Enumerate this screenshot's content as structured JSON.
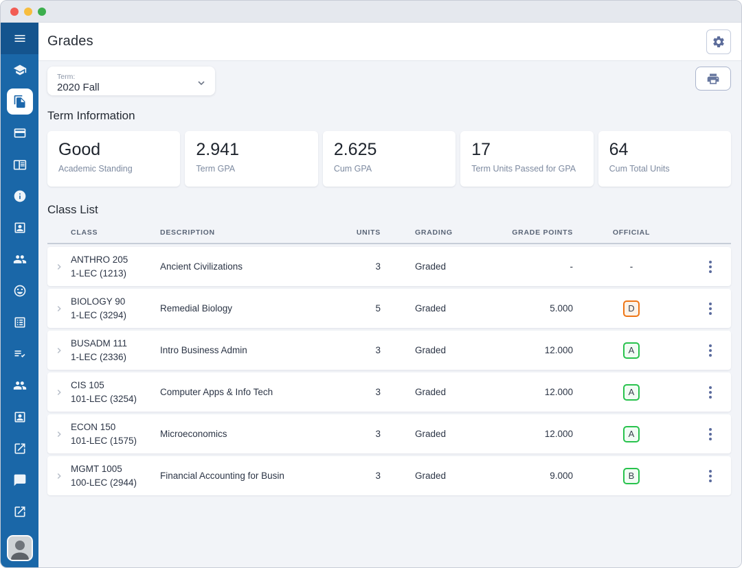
{
  "header": {
    "title": "Grades"
  },
  "toolbar": {
    "term_label": "Term:",
    "term_value": "2020 Fall"
  },
  "term_information": {
    "heading": "Term Information",
    "cards": [
      {
        "value": "Good",
        "label": "Academic Standing"
      },
      {
        "value": "2.941",
        "label": "Term GPA"
      },
      {
        "value": "2.625",
        "label": "Cum GPA"
      },
      {
        "value": "17",
        "label": "Term Units Passed for GPA"
      },
      {
        "value": "64",
        "label": "Cum Total Units"
      }
    ]
  },
  "class_list": {
    "heading": "Class List",
    "columns": [
      "Class",
      "Description",
      "Units",
      "Grading",
      "Grade Points",
      "Official"
    ],
    "rows": [
      {
        "class_code": "ANTHRO 205",
        "section": "1-LEC (1213)",
        "description": "Ancient Civilizations",
        "units": "3",
        "grading": "Graded",
        "grade_points": "-",
        "official": "-",
        "official_type": "none"
      },
      {
        "class_code": "BIOLOGY 90",
        "section": "1-LEC (3294)",
        "description": "Remedial Biology",
        "units": "5",
        "grading": "Graded",
        "grade_points": "5.000",
        "official": "D",
        "official_type": "warning"
      },
      {
        "class_code": "BUSADM 111",
        "section": "1-LEC (2336)",
        "description": "Intro Business Admin",
        "units": "3",
        "grading": "Graded",
        "grade_points": "12.000",
        "official": "A",
        "official_type": "success"
      },
      {
        "class_code": "CIS 105",
        "section": "101-LEC (3254)",
        "description": "Computer Apps & Info Tech",
        "units": "3",
        "grading": "Graded",
        "grade_points": "12.000",
        "official": "A",
        "official_type": "success"
      },
      {
        "class_code": "ECON 150",
        "section": "101-LEC (1575)",
        "description": "Microeconomics",
        "units": "3",
        "grading": "Graded",
        "grade_points": "12.000",
        "official": "A",
        "official_type": "success"
      },
      {
        "class_code": "MGMT 1005",
        "section": "100-LEC (2944)",
        "description": "Financial Accounting for Busin",
        "units": "3",
        "grading": "Graded",
        "grade_points": "9.000",
        "official": "B",
        "official_type": "success"
      }
    ]
  },
  "sidebar": {
    "icons": [
      "menu-icon",
      "school-icon",
      "documents-icon",
      "credit-card-icon",
      "reader-icon",
      "info-icon",
      "contact-badge-icon",
      "people-icon",
      "smiley-icon",
      "list-box-icon",
      "playlist-check-icon",
      "people-icon",
      "contact-badge-icon",
      "external-link-icon",
      "chat-icon",
      "external-link-icon"
    ],
    "active_icon": "documents-icon",
    "avatar": "user-photo"
  },
  "colors": {
    "sidebar": "#1a67a8",
    "sidebar_top": "#14548e",
    "grade_success_border": "#27c24c",
    "grade_warning_border": "#ee7514",
    "slate_icon": "#5d6d9b",
    "traffic_red": "#f25c54",
    "traffic_yellow": "#f7bd3e",
    "traffic_green": "#3cae4d"
  }
}
